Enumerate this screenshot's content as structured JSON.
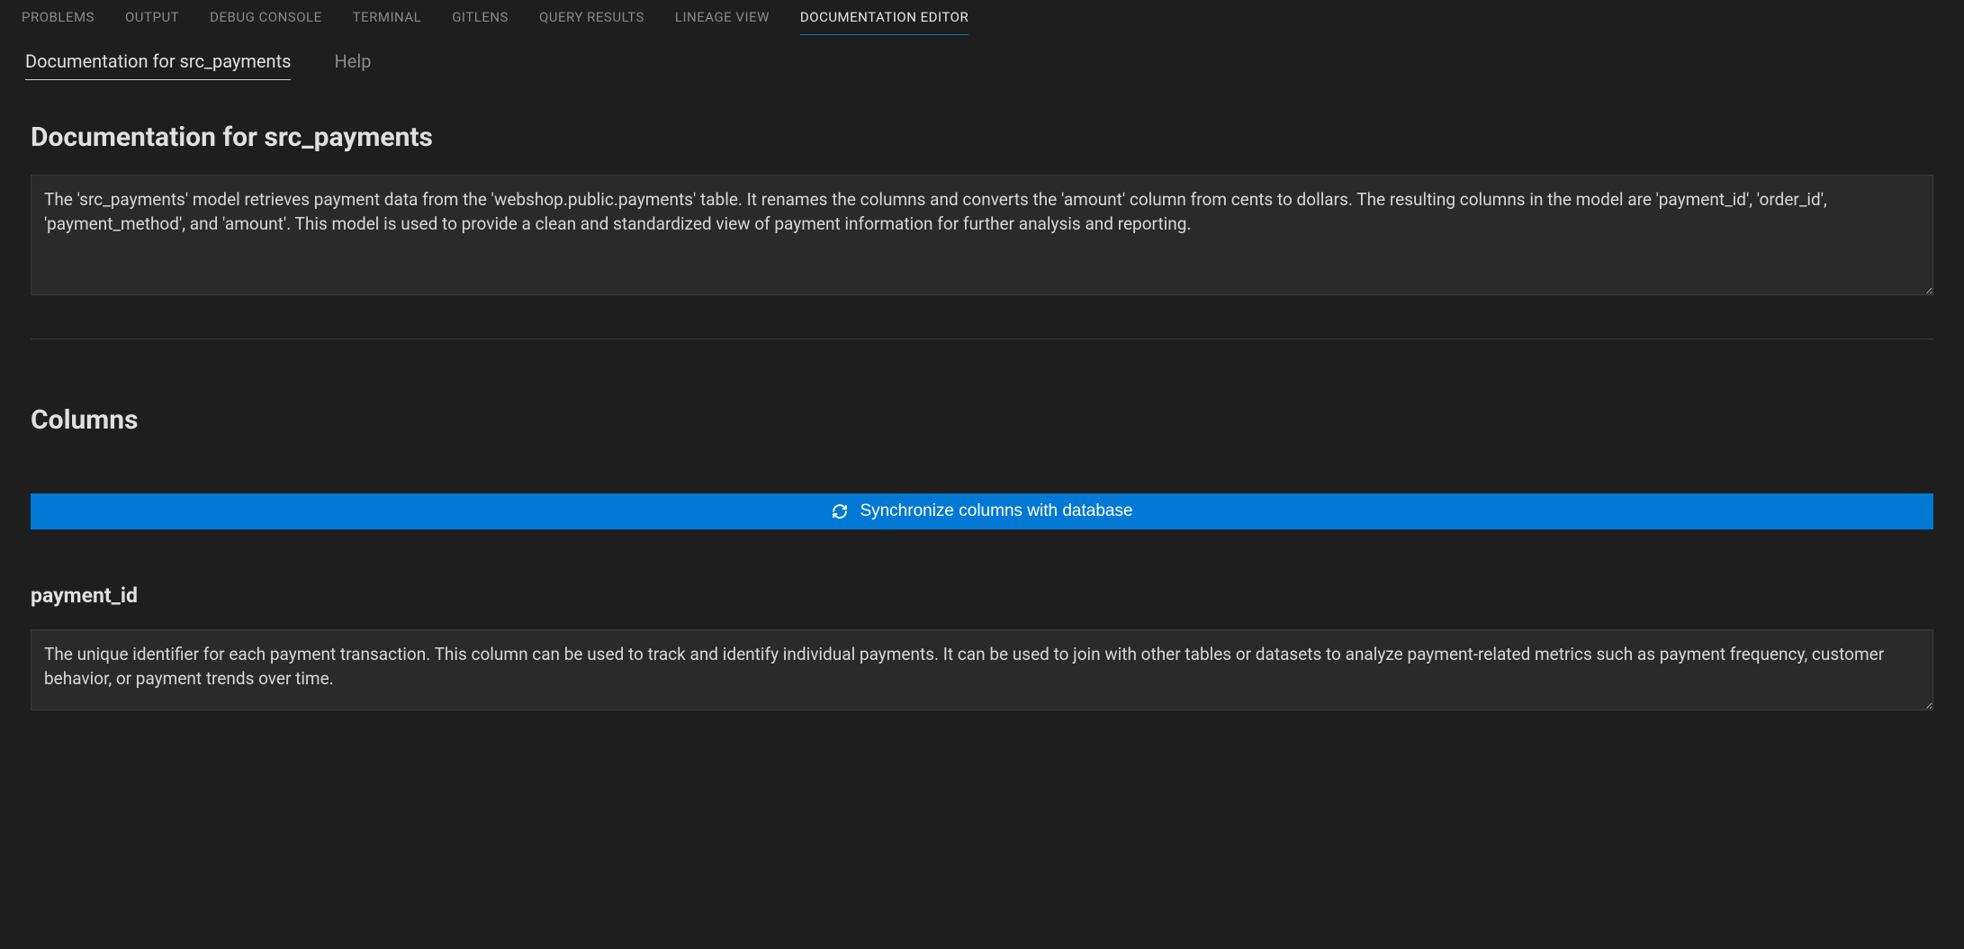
{
  "panelTabs": [
    {
      "label": "PROBLEMS",
      "active": false
    },
    {
      "label": "OUTPUT",
      "active": false
    },
    {
      "label": "DEBUG CONSOLE",
      "active": false
    },
    {
      "label": "TERMINAL",
      "active": false
    },
    {
      "label": "GITLENS",
      "active": false
    },
    {
      "label": "QUERY RESULTS",
      "active": false
    },
    {
      "label": "LINEAGE VIEW",
      "active": false
    },
    {
      "label": "DOCUMENTATION EDITOR",
      "active": true
    }
  ],
  "subTabs": [
    {
      "label": "Documentation for src_payments",
      "active": true
    },
    {
      "label": "Help",
      "active": false
    }
  ],
  "doc": {
    "title": "Documentation for src_payments",
    "description": "The 'src_payments' model retrieves payment data from the 'webshop.public.payments' table. It renames the columns and converts the 'amount' column from cents to dollars. The resulting columns in the model are 'payment_id', 'order_id', 'payment_method', and 'amount'. This model is used to provide a clean and standardized view of payment information for further analysis and reporting."
  },
  "columnsSection": {
    "title": "Columns",
    "syncButtonLabel": "Synchronize columns with database"
  },
  "columns": [
    {
      "name": "payment_id",
      "description": "The unique identifier for each payment transaction. This column can be used to track and identify individual payments. It can be used to join with other tables or datasets to analyze payment-related metrics such as payment frequency, customer behavior, or payment trends over time."
    }
  ]
}
